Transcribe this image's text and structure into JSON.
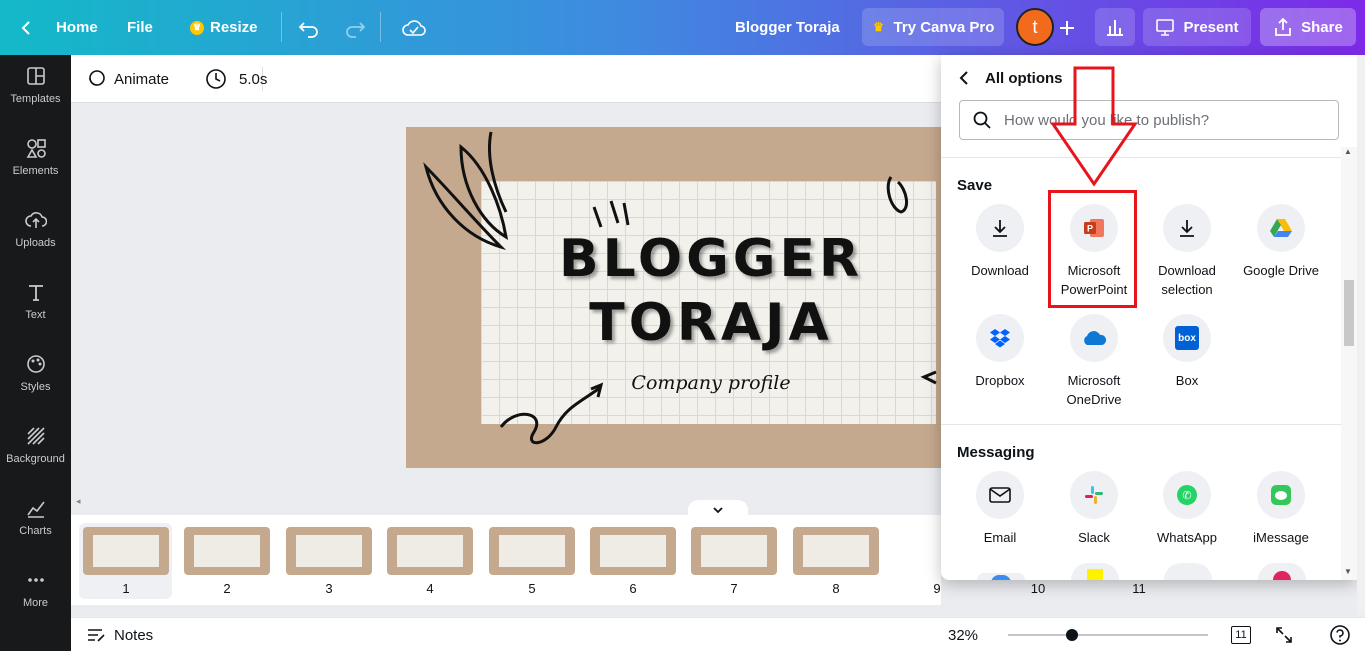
{
  "topbar": {
    "home": "Home",
    "file": "File",
    "resize": "Resize",
    "doc_title": "Blogger Toraja",
    "try_pro": "Try Canva Pro",
    "avatar_letter": "t",
    "present": "Present",
    "share": "Share"
  },
  "sidebar": {
    "items": [
      {
        "label": "Templates",
        "icon": "templates-icon"
      },
      {
        "label": "Elements",
        "icon": "elements-icon"
      },
      {
        "label": "Uploads",
        "icon": "uploads-icon"
      },
      {
        "label": "Text",
        "icon": "text-icon"
      },
      {
        "label": "Styles",
        "icon": "styles-icon"
      },
      {
        "label": "Background",
        "icon": "background-icon"
      },
      {
        "label": "Charts",
        "icon": "charts-icon"
      },
      {
        "label": "More",
        "icon": "more-icon"
      }
    ]
  },
  "editor": {
    "animate": "Animate",
    "duration": "5.0s"
  },
  "slide": {
    "line1": "BLOGGER",
    "line2": "TORAJA",
    "subtitle": "Company profile"
  },
  "pages": [
    "1",
    "2",
    "3",
    "4",
    "5",
    "6",
    "7",
    "8",
    "9",
    "10",
    "11"
  ],
  "footer": {
    "notes": "Notes",
    "zoom": "32%",
    "zoom_fraction": 0.32,
    "page_count": "11"
  },
  "share_panel": {
    "header": "All options",
    "search_placeholder": "How would you like to publish?",
    "save_title": "Save",
    "save_options": [
      {
        "label": "Download",
        "icon": "download-icon"
      },
      {
        "label": "Microsoft PowerPoint",
        "icon": "powerpoint-icon"
      },
      {
        "label": "Download selection",
        "icon": "download-icon"
      },
      {
        "label": "Google Drive",
        "icon": "google-drive-icon"
      },
      {
        "label": "Dropbox",
        "icon": "dropbox-icon"
      },
      {
        "label": "Microsoft OneDrive",
        "icon": "onedrive-icon"
      },
      {
        "label": "Box",
        "icon": "box-icon"
      }
    ],
    "messaging_title": "Messaging",
    "messaging_options": [
      {
        "label": "Email",
        "icon": "email-icon"
      },
      {
        "label": "Slack",
        "icon": "slack-icon"
      },
      {
        "label": "WhatsApp",
        "icon": "whatsapp-icon"
      },
      {
        "label": "iMessage",
        "icon": "imessage-icon"
      }
    ]
  },
  "colors": {
    "highlight": "#e8141c",
    "avatar": "#f26b1d",
    "pro_crown": "#ffc700"
  }
}
